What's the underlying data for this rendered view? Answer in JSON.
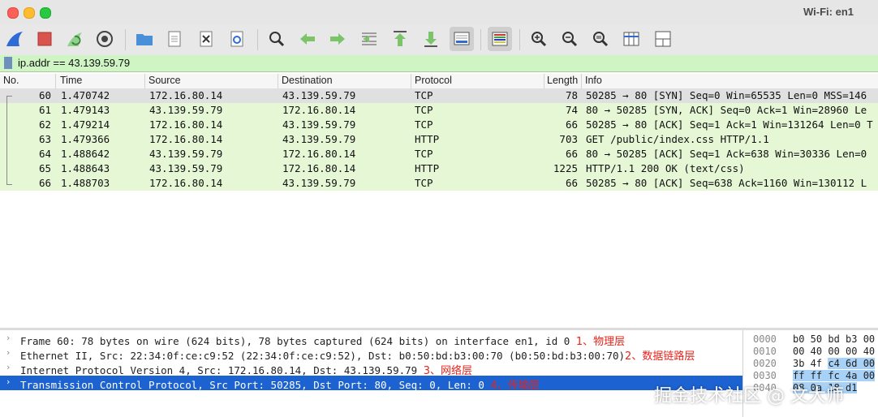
{
  "window": {
    "title": "Wi-Fi: en1"
  },
  "toolbar": {
    "buttons": [
      {
        "name": "shark-fin-start-icon"
      },
      {
        "name": "stop-capture-icon"
      },
      {
        "name": "restart-capture-icon"
      },
      {
        "name": "capture-options-gear-icon"
      },
      {
        "name": "open-folder-icon"
      },
      {
        "name": "save-file-icon"
      },
      {
        "name": "close-file-icon"
      },
      {
        "name": "reload-icon"
      },
      {
        "name": "find-packet-icon"
      },
      {
        "name": "go-back-icon"
      },
      {
        "name": "go-forward-icon"
      },
      {
        "name": "go-to-packet-icon"
      },
      {
        "name": "first-packet-icon"
      },
      {
        "name": "last-packet-icon"
      },
      {
        "name": "autoscroll-icon"
      },
      {
        "name": "colorize-icon"
      },
      {
        "name": "zoom-in-icon"
      },
      {
        "name": "zoom-out-icon"
      },
      {
        "name": "zoom-normal-icon"
      },
      {
        "name": "resize-columns-icon"
      },
      {
        "name": "layout-icon"
      }
    ]
  },
  "filter": {
    "value": "ip.addr == 43.139.59.79"
  },
  "columns": {
    "no": "No.",
    "time": "Time",
    "source": "Source",
    "destination": "Destination",
    "protocol": "Protocol",
    "length": "Length",
    "info": "Info"
  },
  "packets": [
    {
      "no": "60",
      "time": "1.470742",
      "src": "172.16.80.14",
      "dst": "43.139.59.79",
      "proto": "TCP",
      "len": "78",
      "info": "50285 → 80 [SYN] Seq=0 Win=65535 Len=0 MSS=146"
    },
    {
      "no": "61",
      "time": "1.479143",
      "src": "43.139.59.79",
      "dst": "172.16.80.14",
      "proto": "TCP",
      "len": "74",
      "info": "80 → 50285 [SYN, ACK] Seq=0 Ack=1 Win=28960 Le"
    },
    {
      "no": "62",
      "time": "1.479214",
      "src": "172.16.80.14",
      "dst": "43.139.59.79",
      "proto": "TCP",
      "len": "66",
      "info": "50285 → 80 [ACK] Seq=1 Ack=1 Win=131264 Len=0 T"
    },
    {
      "no": "63",
      "time": "1.479366",
      "src": "172.16.80.14",
      "dst": "43.139.59.79",
      "proto": "HTTP",
      "len": "703",
      "info": "GET /public/index.css HTTP/1.1"
    },
    {
      "no": "64",
      "time": "1.488642",
      "src": "43.139.59.79",
      "dst": "172.16.80.14",
      "proto": "TCP",
      "len": "66",
      "info": "80 → 50285 [ACK] Seq=1 Ack=638 Win=30336 Len=0"
    },
    {
      "no": "65",
      "time": "1.488643",
      "src": "43.139.59.79",
      "dst": "172.16.80.14",
      "proto": "HTTP",
      "len": "1225",
      "info": "HTTP/1.1 200 OK  (text/css)"
    },
    {
      "no": "66",
      "time": "1.488703",
      "src": "172.16.80.14",
      "dst": "43.139.59.79",
      "proto": "TCP",
      "len": "66",
      "info": "50285 → 80 [ACK] Seq=638 Ack=1160 Win=130112 L"
    }
  ],
  "details": [
    {
      "text": "Frame 60: 78 bytes on wire (624 bits), 78 bytes captured (624 bits) on interface en1, id 0 ",
      "note": "1、物理层"
    },
    {
      "text": "Ethernet II, Src: 22:34:0f:ce:c9:52 (22:34:0f:ce:c9:52), Dst: b0:50:bd:b3:00:70 (b0:50:bd:b3:00:70)",
      "note": "2、数据链路层"
    },
    {
      "text": "Internet Protocol Version 4, Src: 172.16.80.14, Dst: 43.139.59.79 ",
      "note": "3、网络层"
    },
    {
      "text": "Transmission Control Protocol, Src Port: 50285, Dst Port: 80, Seq: 0, Len: 0 ",
      "note": "4、传输层"
    }
  ],
  "bytes": [
    {
      "offset": "0000",
      "hex_plain": "b0 50 bd b3 00",
      "hex_hl": ""
    },
    {
      "offset": "0010",
      "hex_plain": "00 40 00 00 40",
      "hex_hl": ""
    },
    {
      "offset": "0020",
      "hex_plain": "3b 4f ",
      "hex_hl": "c4 6d 00"
    },
    {
      "offset": "0030",
      "hex_plain": "",
      "hex_hl": "ff ff fc 4a 00"
    },
    {
      "offset": "0040",
      "hex_plain": "",
      "hex_hl": "08 0a 18 d1"
    }
  ],
  "watermark": "掘金技术社区 @ 文大师",
  "colors": {
    "filter_bg": "#d0f5c4",
    "row_green": "#e6f7d6",
    "selected_blue": "#1c62d0",
    "annotation_red": "#e8241c"
  }
}
